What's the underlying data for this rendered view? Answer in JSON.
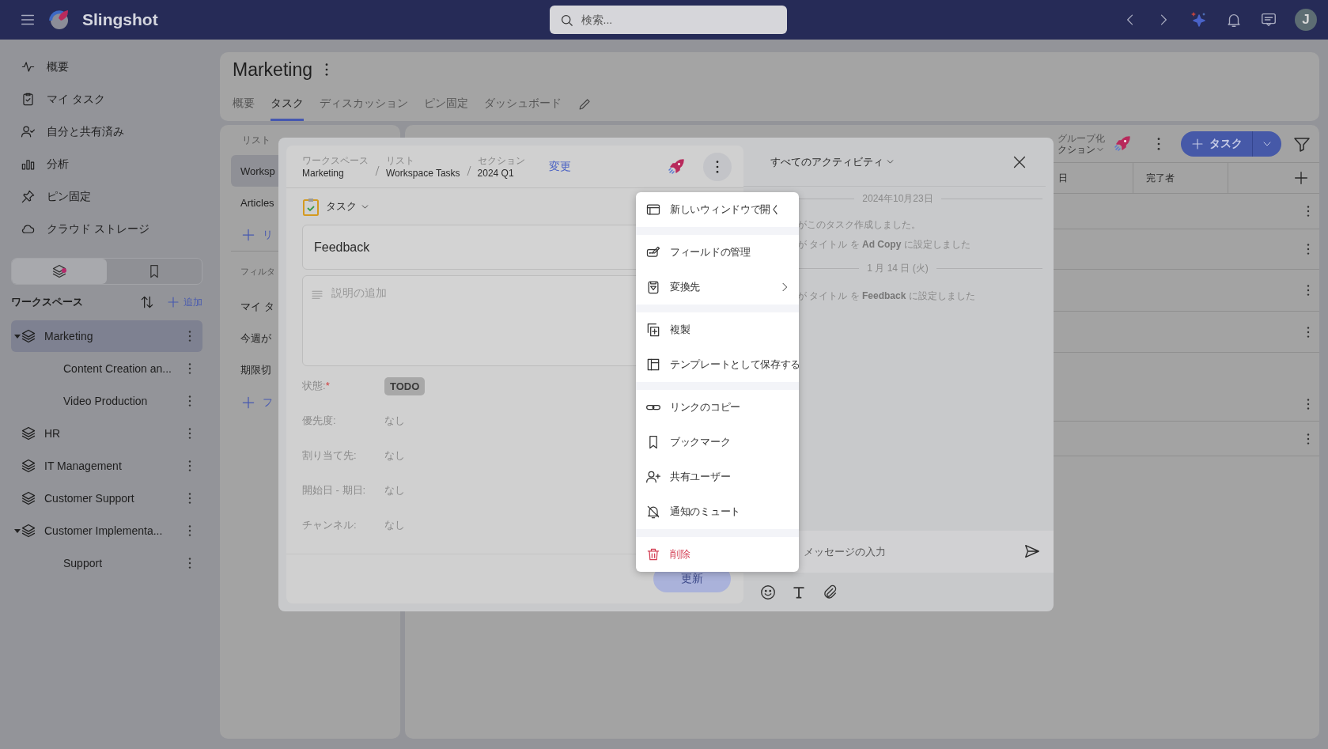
{
  "topbar": {
    "app_name": "Slingshot",
    "search": {
      "placeholder": "検索..."
    },
    "avatar": "J"
  },
  "sidebar": {
    "nav": [
      {
        "label": "概要"
      },
      {
        "label": "マイ タスク"
      },
      {
        "label": "自分と共有済み"
      },
      {
        "label": "分析"
      },
      {
        "label": "ピン固定"
      },
      {
        "label": "クラウド ストレージ"
      }
    ],
    "toggle": [
      {
        "selected": true
      },
      {
        "selected": false
      }
    ],
    "workspaces_title": "ワークスペース",
    "add_label": "追加",
    "workspaces": [
      {
        "label": "Marketing",
        "selected": true,
        "expanded": true,
        "children": [
          {
            "label": "Content Creation an...",
            "selected": false
          },
          {
            "label": "Video Production",
            "selected": false
          }
        ]
      },
      {
        "label": "HR",
        "selected": false,
        "expanded": false
      },
      {
        "label": "IT Management",
        "selected": false,
        "expanded": false
      },
      {
        "label": "Customer Support",
        "selected": false,
        "expanded": false
      },
      {
        "label": "Customer Implementa...",
        "selected": false,
        "expanded": true,
        "children": [
          {
            "label": "Support",
            "selected": false
          }
        ]
      }
    ]
  },
  "page": {
    "title": "Marketing",
    "tabs": [
      {
        "label": "概要",
        "selected": false
      },
      {
        "label": "タスク",
        "selected": true
      },
      {
        "label": "ディスカッション",
        "selected": false
      },
      {
        "label": "ピン固定",
        "selected": false
      },
      {
        "label": "ダッシュボード",
        "selected": false
      }
    ]
  },
  "lists_panel": {
    "heading": "リスト",
    "lists": [
      {
        "label": "Worksp",
        "selected": true
      },
      {
        "label": "Articles",
        "selected": false
      }
    ],
    "add_list": "リ",
    "filters_heading": "フィルタ",
    "filters": [
      {
        "label": "マイ タ"
      },
      {
        "label": "今週が"
      },
      {
        "label": "期限切"
      }
    ],
    "add_filter": "フ"
  },
  "table_panel": {
    "group_label": "グループ化",
    "group_value": "クション",
    "new_task": "タスク",
    "columns": [
      "日",
      "完了者"
    ]
  },
  "task": {
    "breadcrumb": [
      {
        "label": "ワークスペース",
        "value": "Marketing"
      },
      {
        "label": "リスト",
        "value": "Workspace Tasks"
      },
      {
        "label": "セクション",
        "value": "2024 Q1"
      }
    ],
    "change_link": "変更",
    "type": "タスク",
    "title": "Feedback",
    "description": {
      "placeholder": "説明の追加"
    },
    "fields": [
      {
        "label": "状態:",
        "required": true,
        "kind": "status",
        "value": "TODO"
      },
      {
        "label": "優先度:",
        "required": false,
        "kind": "text",
        "value": "なし"
      },
      {
        "label": "割り当て先:",
        "required": false,
        "kind": "text",
        "value": "なし"
      },
      {
        "label": "開始日 - 期日:",
        "required": false,
        "kind": "text",
        "value": "なし"
      },
      {
        "label": "チャンネル:",
        "required": false,
        "kind": "text",
        "value": "なし"
      }
    ],
    "required_mark": "*",
    "save_button": {
      "label": "更新",
      "disabled": true
    }
  },
  "activity": {
    "filter": "すべてのアクティビティ",
    "entries": [
      {
        "kind": "date",
        "text": "2024年10月23日"
      },
      {
        "kind": "event",
        "text": "がこのタスク作成しました。"
      },
      {
        "kind": "event",
        "text": "が タイトル を **Ad Copy** に設定しました"
      },
      {
        "kind": "date",
        "text": "1 月 14 日 (火)"
      },
      {
        "kind": "event",
        "text": "が タイトル を **Feedback** に設定しました"
      }
    ],
    "message": {
      "placeholder": "メッセージの入力"
    }
  },
  "menu": {
    "groups": [
      {
        "items": [
          {
            "label": "新しいウィンドウで開く",
            "kind": "item"
          }
        ]
      },
      {
        "items": [
          {
            "label": "フィールドの管理",
            "kind": "item"
          },
          {
            "label": "変換先",
            "kind": "submenu"
          }
        ]
      },
      {
        "items": [
          {
            "label": "複製",
            "kind": "item"
          },
          {
            "label": "テンプレートとして保存する",
            "kind": "item"
          }
        ]
      },
      {
        "items": [
          {
            "label": "リンクのコピー",
            "kind": "item"
          },
          {
            "label": "ブックマーク",
            "kind": "item"
          },
          {
            "label": "共有ユーザー",
            "kind": "item"
          },
          {
            "label": "通知のミュート",
            "kind": "item"
          }
        ]
      },
      {
        "items": [
          {
            "label": "削除",
            "kind": "danger"
          }
        ]
      }
    ]
  }
}
